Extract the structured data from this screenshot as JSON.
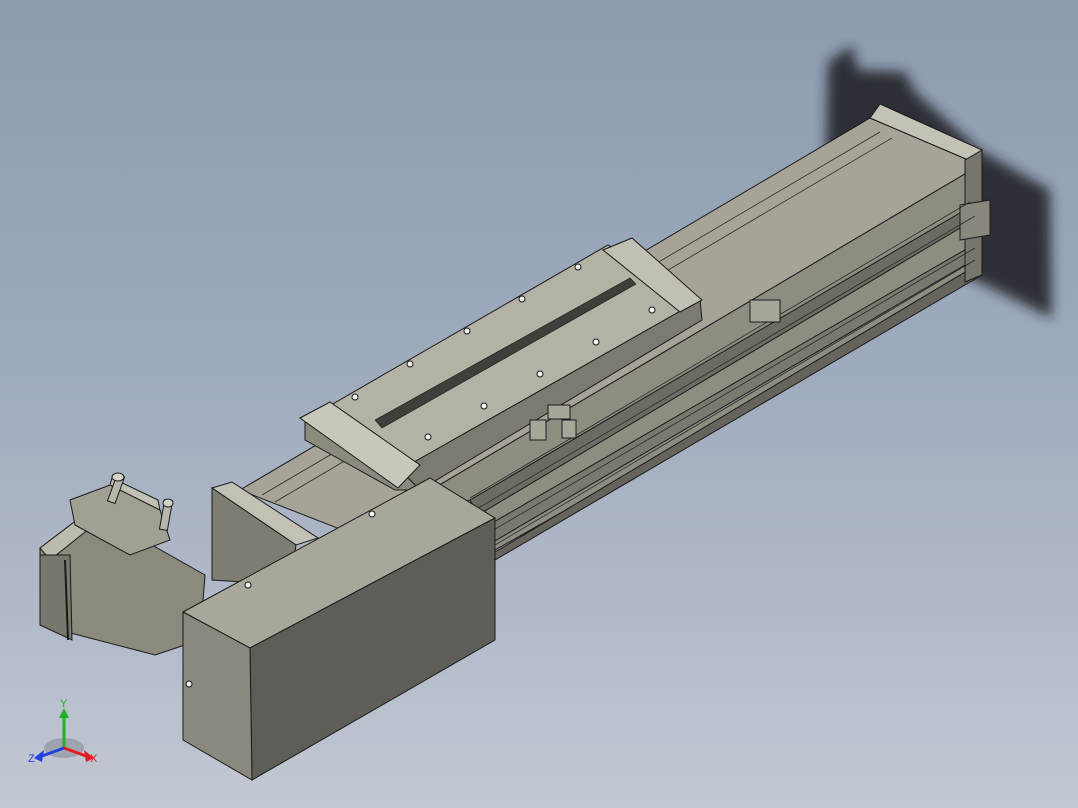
{
  "viewport": {
    "background_top": "#8c9bb0",
    "background_bottom": "#c2c8d3"
  },
  "model": {
    "body_color": "#9a978a",
    "dark_face": "#5f5e59",
    "mid_face": "#878478",
    "light_face": "#b9b6aa",
    "edge_color": "#1a1a1a",
    "shadow_color": "#1e1f24"
  },
  "triad": {
    "x_label": "X",
    "y_label": "Y",
    "z_label": "Z",
    "x_color": "#e02020",
    "y_color": "#20b020",
    "z_color": "#2040e0"
  }
}
